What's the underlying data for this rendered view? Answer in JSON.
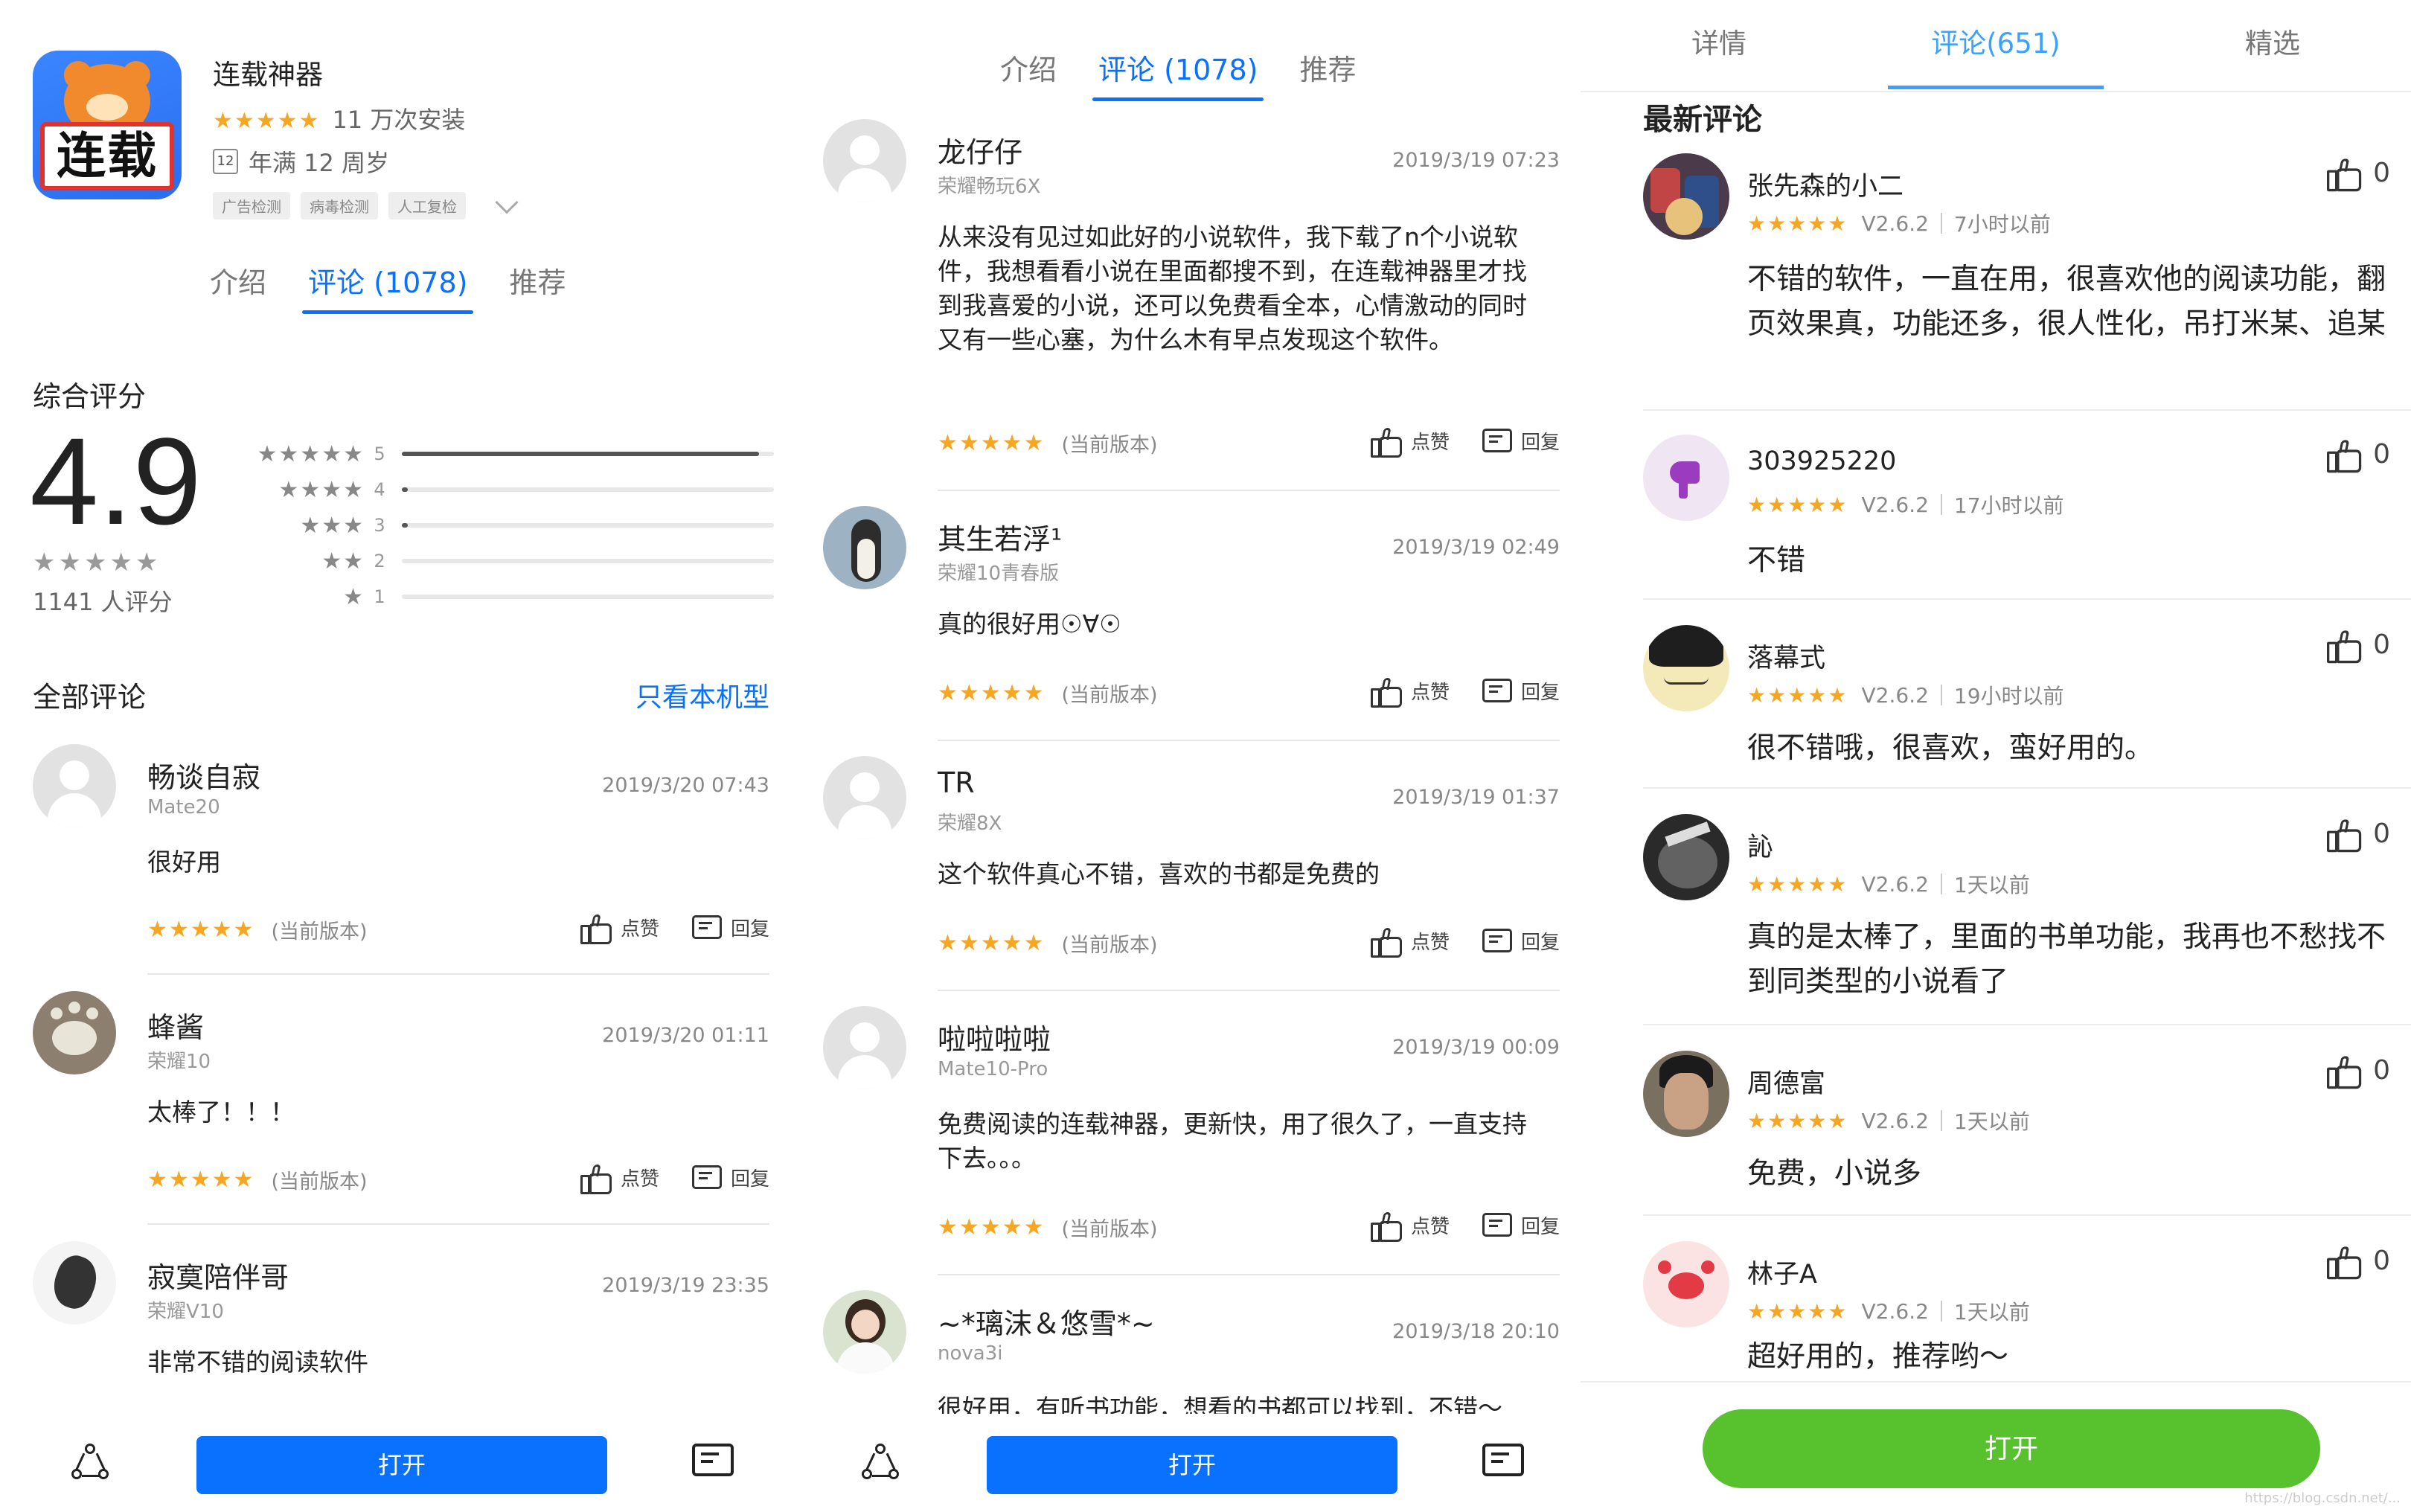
{
  "panel1": {
    "app": {
      "name": "连载神器",
      "icon_label": "连载",
      "stars": "★★★★★",
      "installs": "11 万次安装",
      "age": "年满 12 周岁",
      "age_badge": "12"
    },
    "tags": [
      "广告检测",
      "病毒检测",
      "人工复检"
    ],
    "tabs": [
      "介绍",
      "评论 (1078)",
      "推荐"
    ],
    "active_tab": 1,
    "score_title": "综合评分",
    "score": "4.9",
    "score_stars": "★★★★★",
    "score_count": "1141 人评分",
    "distribution": [
      {
        "stars": "★★★★★",
        "label": "5",
        "fraction": 0.96
      },
      {
        "stars": "★★★★",
        "label": "4",
        "fraction": 0.01
      },
      {
        "stars": "★★★",
        "label": "3",
        "fraction": 0.005
      },
      {
        "stars": "★★",
        "label": "2",
        "fraction": 0
      },
      {
        "stars": "★",
        "label": "1",
        "fraction": 0
      }
    ],
    "all_reviews_title": "全部评论",
    "filter_link": "只看本机型",
    "reviews": [
      {
        "name": "畅谈自寂",
        "device": "Mate20",
        "date": "2019/3/20 07:43",
        "text": "很好用",
        "stars": "★★★★★",
        "version": "(当前版本)",
        "like": "点赞",
        "reply": "回复"
      },
      {
        "name": "蜂酱",
        "device": "荣耀10",
        "date": "2019/3/20 01:11",
        "text": "太棒了！！！",
        "stars": "★★★★★",
        "version": "(当前版本)",
        "like": "点赞",
        "reply": "回复"
      },
      {
        "name": "寂寞陪伴哥",
        "device": "荣耀V10",
        "date": "2019/3/19 23:35",
        "text": "非常不错的阅读软件"
      }
    ],
    "open_button": "打开"
  },
  "panel2": {
    "tabs": [
      "介绍",
      "评论 (1078)",
      "推荐"
    ],
    "reviews": [
      {
        "name": "龙仔仔",
        "device": "荣耀畅玩6X",
        "date": "2019/3/19 07:23",
        "text": "从来没有见过如此好的小说软件，我下载了n个小说软件，我想看看小说在里面都搜不到，在连载神器里才找到我喜爱的小说，还可以免费看全本，心情激动的同时又有一些心塞，为什么木有早点发现这个软件。",
        "stars": "★★★★★",
        "version": "(当前版本)",
        "like": "点赞",
        "reply": "回复"
      },
      {
        "name": "其生若浮¹",
        "device": "荣耀10青春版",
        "date": "2019/3/19 02:49",
        "text": "真的很好用☉∀☉",
        "stars": "★★★★★",
        "version": "(当前版本)",
        "like": "点赞",
        "reply": "回复"
      },
      {
        "name": "TR",
        "device": "荣耀8X",
        "date": "2019/3/19 01:37",
        "text": "这个软件真心不错，喜欢的书都是免费的",
        "stars": "★★★★★",
        "version": "(当前版本)",
        "like": "点赞",
        "reply": "回复"
      },
      {
        "name": "啦啦啦啦",
        "device": "Mate10-Pro",
        "date": "2019/3/19 00:09",
        "text": "免费阅读的连载神器，更新快，用了很久了，一直支持下去。。。",
        "stars": "★★★★★",
        "version": "(当前版本)",
        "like": "点赞",
        "reply": "回复"
      },
      {
        "name": "~*璃沫＆悠雪*~",
        "device": "nova3i",
        "date": "2019/3/18 20:10",
        "text": "很好用，有听书功能，想看的书都可以找到，不错～"
      }
    ],
    "open_button": "打开"
  },
  "panel3": {
    "tabs": [
      "详情",
      "评论(651)",
      "精选"
    ],
    "section_title": "最新评论",
    "reviews": [
      {
        "name": "张先森的小二",
        "stars": "★★★★★",
        "version": "V2.6.2",
        "time": "7小时以前",
        "likes": "0",
        "text": "不错的软件，一直在用，很喜欢他的阅读功能，翻页效果真，功能还多，很人性化，吊打米某、追某"
      },
      {
        "name": "303925220",
        "stars": "★★★★★",
        "version": "V2.6.2",
        "time": "17小时以前",
        "likes": "0",
        "text": "不错"
      },
      {
        "name": "落幕式",
        "stars": "★★★★★",
        "version": "V2.6.2",
        "time": "19小时以前",
        "likes": "0",
        "text": "很不错哦，很喜欢，蛮好用的。"
      },
      {
        "name": "訫",
        "stars": "★★★★★",
        "version": "V2.6.2",
        "time": "1天以前",
        "likes": "0",
        "text": "真的是太棒了，里面的书单功能，我再也不愁找不到同类型的小说看了"
      },
      {
        "name": "周德富",
        "stars": "★★★★★",
        "version": "V2.6.2",
        "time": "1天以前",
        "likes": "0",
        "text": "免费，小说多"
      },
      {
        "name": "林子A",
        "stars": "★★★★★",
        "version": "V2.6.2",
        "time": "1天以前",
        "likes": "0",
        "text": "超好用的，推荐哟～"
      }
    ],
    "open_button": "打开",
    "watermark": "https://blog.csdn.net/..."
  },
  "colors": {
    "accent_blue": "#0a71ff",
    "tab_blue_p3": "#3aa1ff",
    "star_orange": "#f5a623",
    "open_green": "#57c22e"
  }
}
